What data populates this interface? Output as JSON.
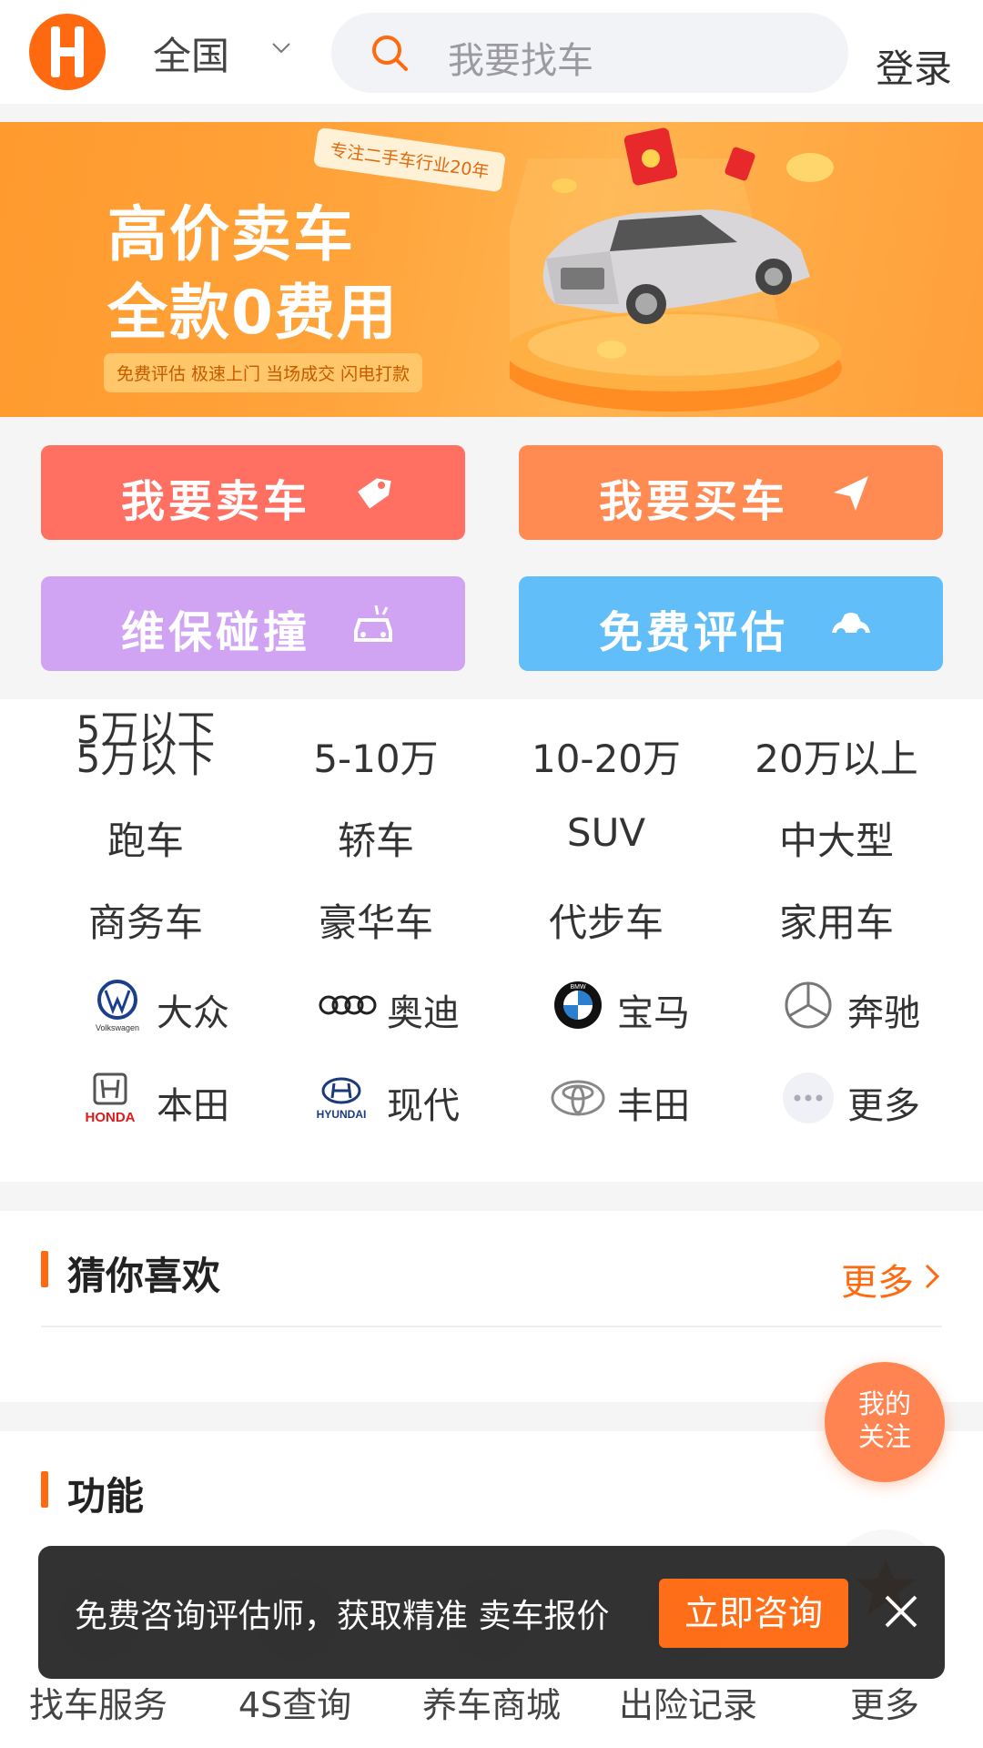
{
  "header": {
    "city": "全国",
    "search_placeholder": "我要找车",
    "login": "登录"
  },
  "banner": {
    "tag": "专注二手车行业20年",
    "title1": "高价卖车",
    "title2": "全款0费用",
    "strip": "免费评估 极速上门 当场成交 闪电打款"
  },
  "actions": {
    "sell": "我要卖车",
    "buy": "我要买车",
    "repair": "维保碰撞",
    "evaluate": "免费评估"
  },
  "price_filters": [
    "5万以下",
    "5-10万",
    "10-20万",
    "20万以上"
  ],
  "type_filters": [
    "跑车",
    "轿车",
    "SUV",
    "中大型"
  ],
  "use_filters": [
    "商务车",
    "豪华车",
    "代步车",
    "家用车"
  ],
  "brands": [
    {
      "name": "大众",
      "logo_text": "Volkswagen"
    },
    {
      "name": "奥迪"
    },
    {
      "name": "宝马",
      "logo_text": "BMW"
    },
    {
      "name": "奔驰"
    },
    {
      "name": "本田",
      "logo_text": "HONDA"
    },
    {
      "name": "现代",
      "logo_text": "HYUNDAI"
    },
    {
      "name": "丰田"
    },
    {
      "name": "更多"
    }
  ],
  "guess": {
    "title": "猜你喜欢",
    "more": "更多"
  },
  "functions": {
    "title": "功能",
    "items": [
      "找车服务",
      "4S查询",
      "养车商城",
      "出险记录",
      "更多"
    ]
  },
  "follow": {
    "line1": "我的",
    "line2": "关注"
  },
  "toast": {
    "text": "免费咨询评估师，获取精准 卖车报价",
    "button": "立即咨询"
  },
  "colors": {
    "brand_orange": "#ff6a10",
    "sell": "#ff6f62",
    "buy": "#ff8a52",
    "repair": "#d0a4f2",
    "evaluate": "#61bef9"
  }
}
